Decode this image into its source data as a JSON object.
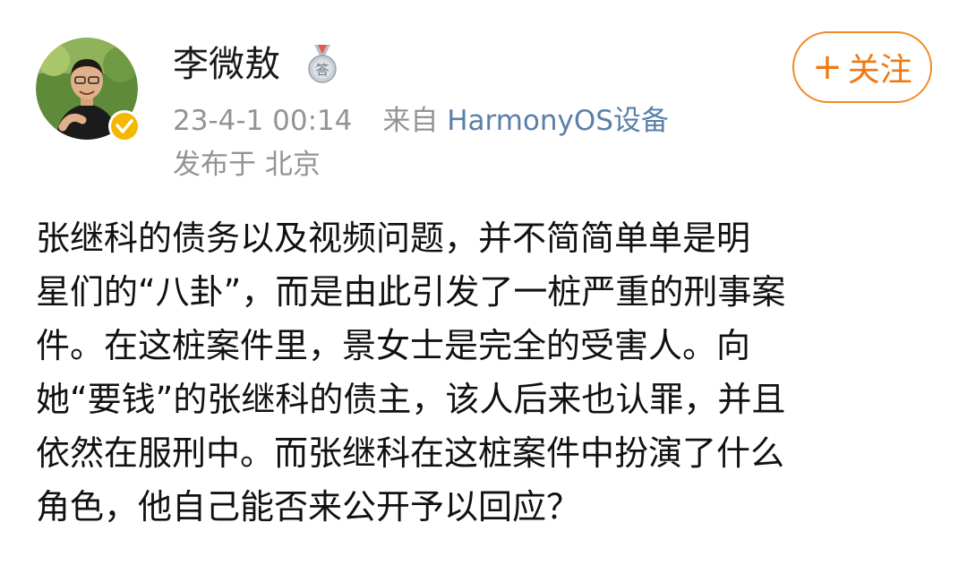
{
  "post": {
    "author": {
      "name": "李微敖",
      "avatar": "avatar-photo",
      "verified_icon": "verified-badge-icon",
      "medal_icon": "medal-icon",
      "medal_text": "答"
    },
    "follow_button": {
      "icon": "plus-icon",
      "label": "关注"
    },
    "meta": {
      "time": "23-4-1 00:14",
      "source_prefix": "来自",
      "device": "HarmonyOS设备",
      "location": "发布于 北京"
    },
    "content_lines": [
      "张继科的债务以及视频问题，并不简简单单是明",
      "星们的“八卦”，而是由此引发了一桩严重的刑事案",
      "件。在这桩案件里，景女士是完全的受害人。向",
      "她“要钱”的张继科的债主，该人后来也认罪，并且",
      "依然在服刑中。而张继科在这桩案件中扮演了什么",
      "角色，他自己能否来公开予以回应？"
    ]
  },
  "colors": {
    "accent_orange": "#ee7a12",
    "meta_gray": "#939393",
    "device_blue": "#5a7fa8",
    "verified_yellow": "#f5b800"
  }
}
